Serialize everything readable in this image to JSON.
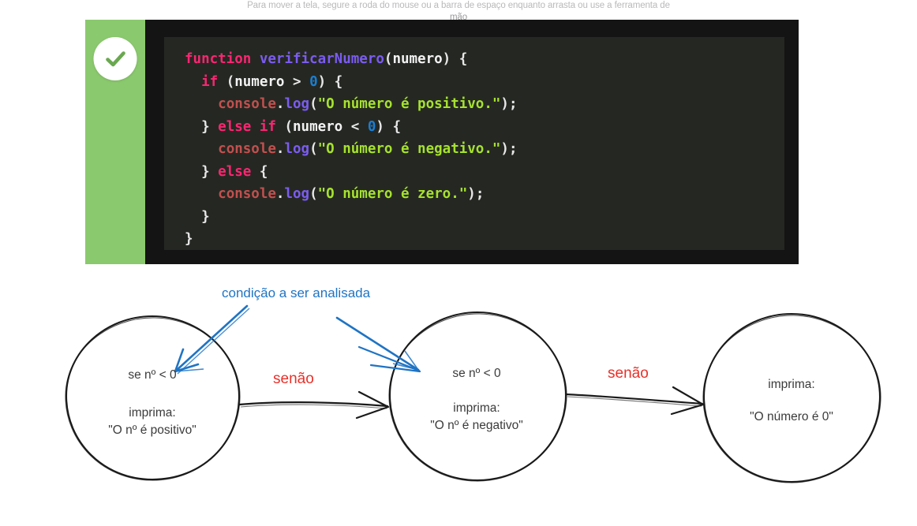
{
  "hint": {
    "line1": "Para mover a tela, segure a roda do mouse ou a barra de espaço enquanto arrasta ou use a ferramenta de",
    "line2": "mão"
  },
  "code_card": {
    "status_icon": "check-circle-icon",
    "status_color": "#8bc96e",
    "background": "#252822",
    "language": "javascript",
    "lines": [
      {
        "n": 1,
        "text": "function verificarNumero(numero) {",
        "tokens": [
          {
            "t": "function",
            "c": "tok-kw"
          },
          {
            "t": " ",
            "c": "tok-punct"
          },
          {
            "t": "verificarNumero",
            "c": "tok-fn"
          },
          {
            "t": "(",
            "c": "tok-punct"
          },
          {
            "t": "numero",
            "c": "tok-var"
          },
          {
            "t": ") {",
            "c": "tok-punct"
          }
        ]
      },
      {
        "n": 2,
        "text": "  if (numero > 0) {",
        "tokens": [
          {
            "t": "  ",
            "c": "tok-punct"
          },
          {
            "t": "if",
            "c": "tok-kw"
          },
          {
            "t": " (",
            "c": "tok-punct"
          },
          {
            "t": "numero",
            "c": "tok-var"
          },
          {
            "t": " > ",
            "c": "tok-punct"
          },
          {
            "t": "0",
            "c": "tok-num"
          },
          {
            "t": ") {",
            "c": "tok-punct"
          }
        ]
      },
      {
        "n": 3,
        "text": "    console.log(\"O número é positivo.\");",
        "tokens": [
          {
            "t": "    ",
            "c": "tok-punct"
          },
          {
            "t": "console",
            "c": "tok-obj"
          },
          {
            "t": ".",
            "c": "tok-punct"
          },
          {
            "t": "log",
            "c": "tok-method"
          },
          {
            "t": "(",
            "c": "tok-punct"
          },
          {
            "t": "\"O número é positivo.\"",
            "c": "tok-str"
          },
          {
            "t": ");",
            "c": "tok-punct"
          }
        ]
      },
      {
        "n": 4,
        "text": "  } else if (numero < 0) {",
        "tokens": [
          {
            "t": "  } ",
            "c": "tok-punct"
          },
          {
            "t": "else if",
            "c": "tok-kw"
          },
          {
            "t": " (",
            "c": "tok-punct"
          },
          {
            "t": "numero",
            "c": "tok-var"
          },
          {
            "t": " < ",
            "c": "tok-punct"
          },
          {
            "t": "0",
            "c": "tok-num"
          },
          {
            "t": ") {",
            "c": "tok-punct"
          }
        ]
      },
      {
        "n": 5,
        "text": "    console.log(\"O número é negativo.\");",
        "tokens": [
          {
            "t": "    ",
            "c": "tok-punct"
          },
          {
            "t": "console",
            "c": "tok-obj"
          },
          {
            "t": ".",
            "c": "tok-punct"
          },
          {
            "t": "log",
            "c": "tok-method"
          },
          {
            "t": "(",
            "c": "tok-punct"
          },
          {
            "t": "\"O número é negativo.\"",
            "c": "tok-str"
          },
          {
            "t": ");",
            "c": "tok-punct"
          }
        ]
      },
      {
        "n": 6,
        "text": "  } else {",
        "tokens": [
          {
            "t": "  } ",
            "c": "tok-punct"
          },
          {
            "t": "else",
            "c": "tok-kw"
          },
          {
            "t": " {",
            "c": "tok-punct"
          }
        ]
      },
      {
        "n": 7,
        "text": "    console.log(\"O número é zero.\");",
        "tokens": [
          {
            "t": "    ",
            "c": "tok-punct"
          },
          {
            "t": "console",
            "c": "tok-obj"
          },
          {
            "t": ".",
            "c": "tok-punct"
          },
          {
            "t": "log",
            "c": "tok-method"
          },
          {
            "t": "(",
            "c": "tok-punct"
          },
          {
            "t": "\"O número é zero.\"",
            "c": "tok-str"
          },
          {
            "t": ");",
            "c": "tok-punct"
          }
        ]
      },
      {
        "n": 8,
        "text": "  }",
        "tokens": [
          {
            "t": "  }",
            "c": "tok-punct"
          }
        ]
      },
      {
        "n": 9,
        "text": "}",
        "tokens": [
          {
            "t": "}",
            "c": "tok-punct"
          }
        ]
      }
    ]
  },
  "diagram": {
    "annotation": {
      "label": "condição a ser analisada",
      "color": "#1f74c4"
    },
    "edge_label_color": "#e8312a",
    "nodes": [
      {
        "id": "node-positivo",
        "condition": "se nº < 0",
        "action_label": "imprima:",
        "action_value": "\"O nº é positivo\""
      },
      {
        "id": "node-negativo",
        "condition": "se nº < 0",
        "action_label": "imprima:",
        "action_value": "\"O nº é negativo\""
      },
      {
        "id": "node-zero",
        "condition": "",
        "action_label": "imprima:",
        "action_value": "\"O número é 0\""
      }
    ],
    "edges": [
      {
        "id": "edge-1",
        "label": "senão",
        "from": "node-positivo",
        "to": "node-negativo"
      },
      {
        "id": "edge-2",
        "label": "senão",
        "from": "node-negativo",
        "to": "node-zero"
      }
    ]
  }
}
